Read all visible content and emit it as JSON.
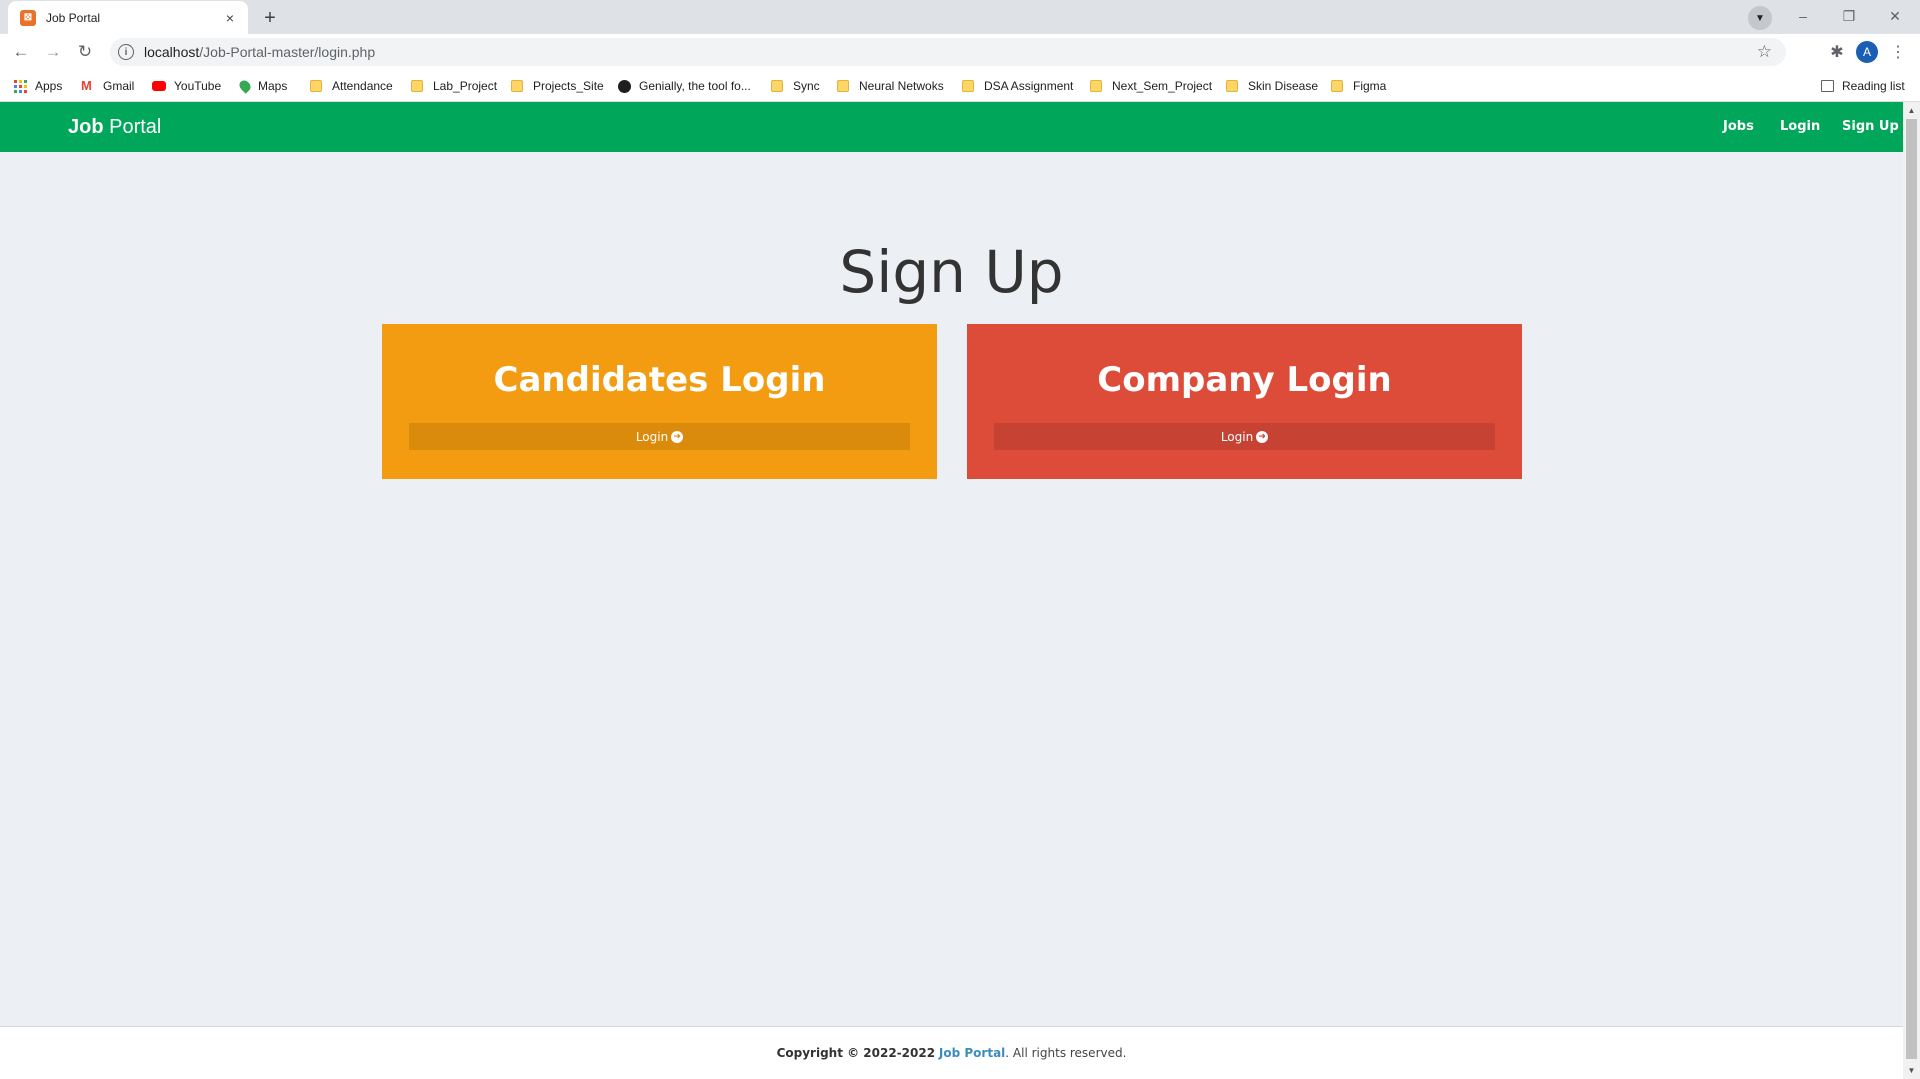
{
  "browser": {
    "tab_title": "Job Portal",
    "tab_close": "×",
    "new_tab": "+",
    "url_host": "localhost",
    "url_path": "/Job-Portal-master/login.php",
    "avatar_letter": "A",
    "window_minimize": "–",
    "window_restore": "❐",
    "window_close": "✕"
  },
  "bookmarks": {
    "items": [
      {
        "label": "Apps",
        "icon": "apps-grid-icon"
      },
      {
        "label": "Gmail",
        "icon": "gmail-icon"
      },
      {
        "label": "YouTube",
        "icon": "youtube-icon"
      },
      {
        "label": "Maps",
        "icon": "maps-icon"
      },
      {
        "label": "Attendance",
        "icon": "folder-icon"
      },
      {
        "label": "Lab_Project",
        "icon": "folder-icon"
      },
      {
        "label": "Projects_Site",
        "icon": "folder-icon"
      },
      {
        "label": "Genially, the tool fo...",
        "icon": "genially-icon"
      },
      {
        "label": "Sync",
        "icon": "folder-icon"
      },
      {
        "label": "Neural Netwoks",
        "icon": "folder-icon"
      },
      {
        "label": "DSA Assignment",
        "icon": "folder-icon"
      },
      {
        "label": "Next_Sem_Project",
        "icon": "folder-icon"
      },
      {
        "label": "Skin Disease",
        "icon": "folder-icon"
      },
      {
        "label": "Figma",
        "icon": "folder-icon"
      }
    ],
    "reading_list": "Reading list"
  },
  "navbar": {
    "brand_bold": "Job",
    "brand_rest": " Portal",
    "links": [
      "Jobs",
      "Login",
      "Sign Up"
    ],
    "color": "#00a65a"
  },
  "main": {
    "heading": "Sign Up",
    "cards": [
      {
        "title": "Candidates Login",
        "button": "Login",
        "color": "#f39c12"
      },
      {
        "title": "Company Login",
        "button": "Login",
        "color": "#dd4b39"
      }
    ]
  },
  "footer": {
    "copyright": "Copyright © 2022-2022",
    "brand_link": "Job Portal",
    "rights": ". All rights reserved."
  }
}
